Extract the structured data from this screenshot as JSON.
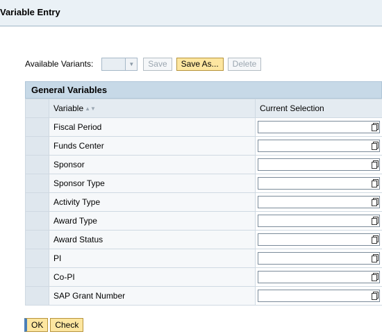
{
  "page": {
    "title": "Variable Entry"
  },
  "variants": {
    "label": "Available Variants:",
    "selected": "",
    "save_label": "Save",
    "save_as_label": "Save As...",
    "delete_label": "Delete"
  },
  "panel": {
    "title": "General Variables",
    "columns": {
      "variable": "Variable",
      "current_selection": "Current Selection"
    },
    "rows": [
      {
        "name": "Fiscal Period",
        "value": ""
      },
      {
        "name": "Funds Center",
        "value": ""
      },
      {
        "name": "Sponsor",
        "value": ""
      },
      {
        "name": "Sponsor Type",
        "value": ""
      },
      {
        "name": "Activity Type",
        "value": ""
      },
      {
        "name": "Award Type",
        "value": ""
      },
      {
        "name": "Award Status",
        "value": ""
      },
      {
        "name": "PI",
        "value": ""
      },
      {
        "name": "Co-PI",
        "value": ""
      },
      {
        "name": "SAP Grant Number",
        "value": ""
      }
    ]
  },
  "footer": {
    "ok_label": "OK",
    "check_label": "Check"
  },
  "colors": {
    "header_bg": "#c7d9e7",
    "active_button": "#fde6a0",
    "title_bar": "#eaf1f6"
  }
}
